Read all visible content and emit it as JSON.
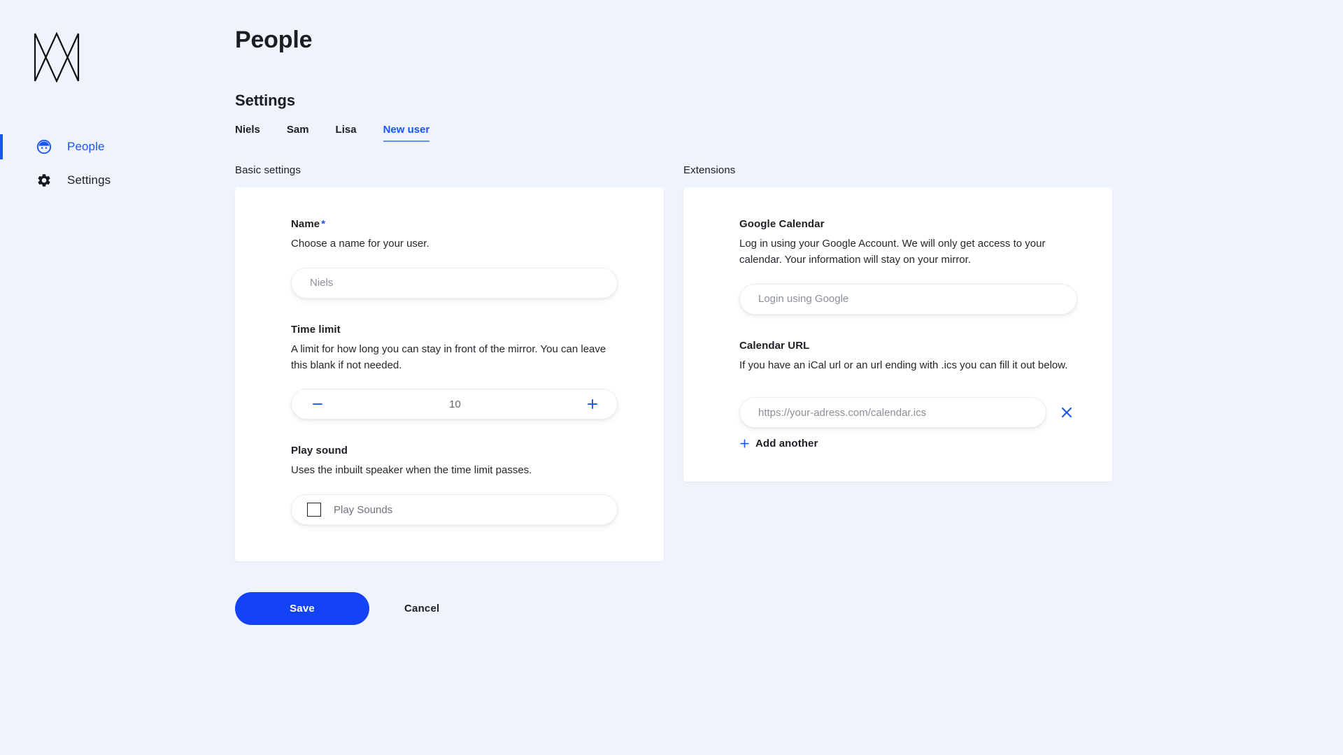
{
  "brand": {
    "logo_name": "mirror-logo"
  },
  "accent": {
    "blue": "#1a56f0",
    "save_blue": "#1343f5",
    "background": "#eef3fd",
    "card": "#ffffff"
  },
  "sidebar": {
    "items": [
      {
        "label": "People",
        "icon": "person-face-icon",
        "active": true
      },
      {
        "label": "Settings",
        "icon": "gear-icon",
        "active": false
      }
    ]
  },
  "header": {
    "title": "People"
  },
  "settings": {
    "heading": "Settings",
    "tabs": [
      {
        "label": "Niels",
        "active": false
      },
      {
        "label": "Sam",
        "active": false
      },
      {
        "label": "Lisa",
        "active": false
      },
      {
        "label": "New user",
        "active": true
      }
    ]
  },
  "basic": {
    "column_label": "Basic settings",
    "name": {
      "label": "Name",
      "required_marker": "*",
      "description": "Choose a name for your user.",
      "placeholder": "Niels",
      "value": ""
    },
    "time_limit": {
      "label": "Time limit",
      "description": "A limit for how long you can stay in front of the mirror. You can leave this blank if not needed.",
      "value": "10",
      "decrement_icon": "minus-icon",
      "increment_icon": "plus-icon"
    },
    "play_sound": {
      "label": "Play sound",
      "description": "Uses the inbuilt speaker when the time limit passes.",
      "checkbox_label": "Play Sounds",
      "checked": false
    }
  },
  "extensions": {
    "column_label": "Extensions",
    "google_calendar": {
      "label": "Google Calendar",
      "description": "Log in using your Google Account. We will only get access to your calendar. Your information will stay on your mirror.",
      "button_label": "Login using Google"
    },
    "calendar_url": {
      "label": "Calendar URL",
      "description": "If you have an iCal url or an url ending with .ics you can fill it out below.",
      "placeholder": "https://your-adress.com/calendar.ics",
      "value": "",
      "remove_icon": "close-icon",
      "add_another_label": "Add another",
      "add_icon": "plus-icon"
    }
  },
  "actions": {
    "save_label": "Save",
    "cancel_label": "Cancel"
  }
}
